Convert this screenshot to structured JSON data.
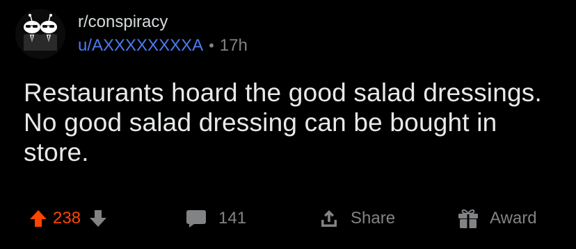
{
  "post": {
    "subreddit": "r/conspiracy",
    "username": "u/AXXXXXXXXA",
    "separator": "•",
    "time_ago": "17h",
    "title": "Restaurants hoard the good salad dressings. No good salad dressing can be bought in store."
  },
  "actions": {
    "vote_count": "238",
    "comment_count": "141",
    "share_label": "Share",
    "award_label": "Award"
  },
  "colors": {
    "background": "#000000",
    "upvote_active": "#ff4500",
    "username": "#4a7cf2",
    "muted": "#818384"
  },
  "icons": {
    "avatar": "snoo-avatar-sunglasses",
    "upvote": "upvote-arrow-icon",
    "downvote": "downvote-arrow-icon",
    "comment": "comment-bubble-icon",
    "share": "share-icon",
    "award": "gift-box-icon"
  }
}
